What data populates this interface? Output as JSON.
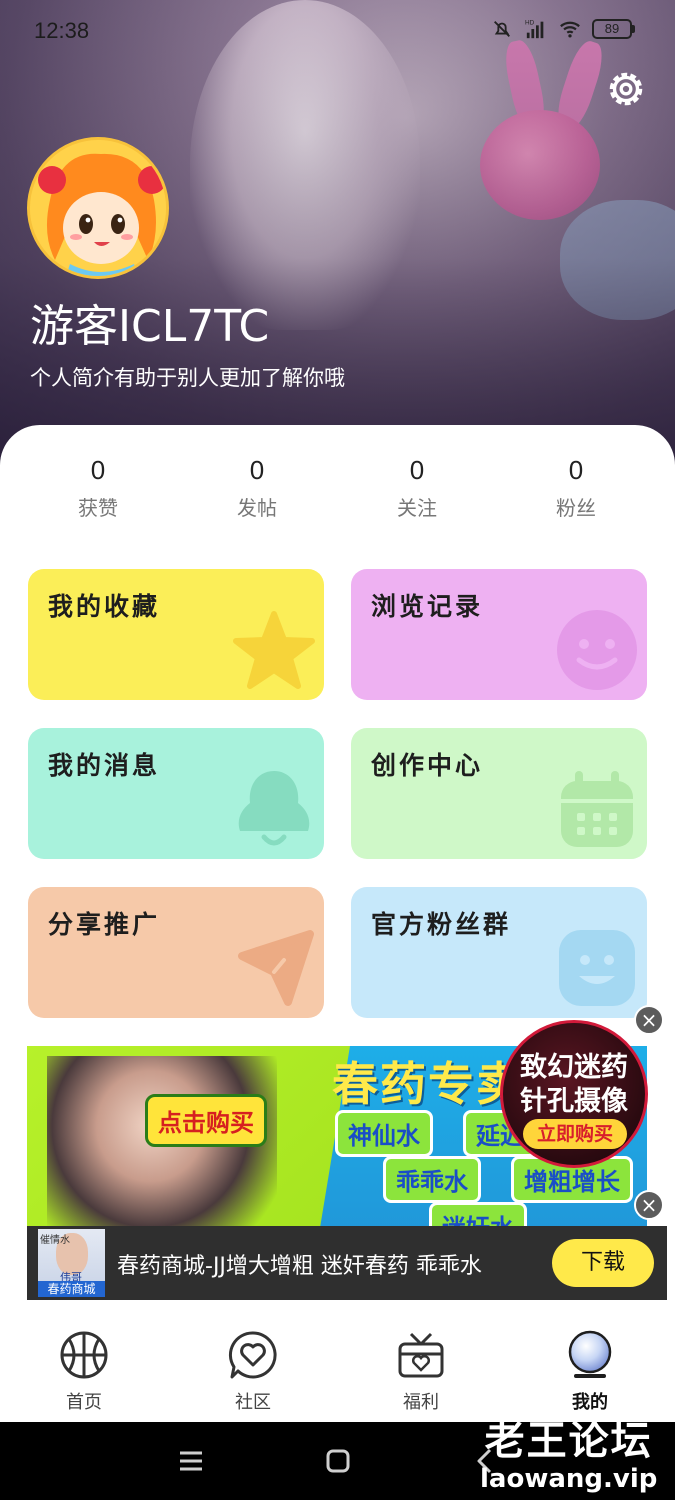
{
  "status_bar": {
    "time": "12:38",
    "network": "HD",
    "battery": "89"
  },
  "profile": {
    "username": "游客ICL7TC",
    "bio": "个人简介有助于别人更加了解你哦"
  },
  "stats": [
    {
      "value": "0",
      "label": "获赞"
    },
    {
      "value": "0",
      "label": "发帖"
    },
    {
      "value": "0",
      "label": "关注"
    },
    {
      "value": "0",
      "label": "粉丝"
    }
  ],
  "tiles": [
    {
      "label": "我的收藏",
      "color": "#fbee58",
      "icon": "star-icon"
    },
    {
      "label": "浏览记录",
      "color": "#eeb1f2",
      "icon": "smile-face-icon"
    },
    {
      "label": "我的消息",
      "color": "#a8f2dc",
      "icon": "bell-icon"
    },
    {
      "label": "创作中心",
      "color": "#cff8c8",
      "icon": "calendar-icon"
    },
    {
      "label": "分享推广",
      "color": "#f6c9a9",
      "icon": "send-icon"
    },
    {
      "label": "官方粉丝群",
      "color": "#c6e8fa",
      "icon": "group-face-icon"
    }
  ],
  "ad": {
    "button_left": "点击购买",
    "title": "春药专卖",
    "tags": [
      "神仙水",
      "延迟",
      "乖乖水",
      "增粗增长",
      "迷奸水"
    ],
    "circle_line1": "致幻迷药",
    "circle_line2": "针孔摄像",
    "circle_button": "立即购买",
    "close": "×"
  },
  "download_bar": {
    "thumb_top": "催情水",
    "thumb_mid": "伟哥",
    "thumb_caption": "春药商城",
    "text": "春药商城-JJ增大增粗 迷奸春药 乖乖水",
    "button": "下载",
    "close": "×"
  },
  "bottom_nav": [
    {
      "label": "首页",
      "icon": "basketball-icon"
    },
    {
      "label": "社区",
      "icon": "heart-chat-icon"
    },
    {
      "label": "福利",
      "icon": "gift-box-icon"
    },
    {
      "label": "我的",
      "icon": "profile-orb-icon",
      "active": true
    }
  ],
  "watermark": {
    "line1": "老王论坛",
    "line2": "laowang.vip"
  },
  "colors": {
    "accent_yellow": "#ffe94a",
    "card_bg": "#ffffff"
  }
}
